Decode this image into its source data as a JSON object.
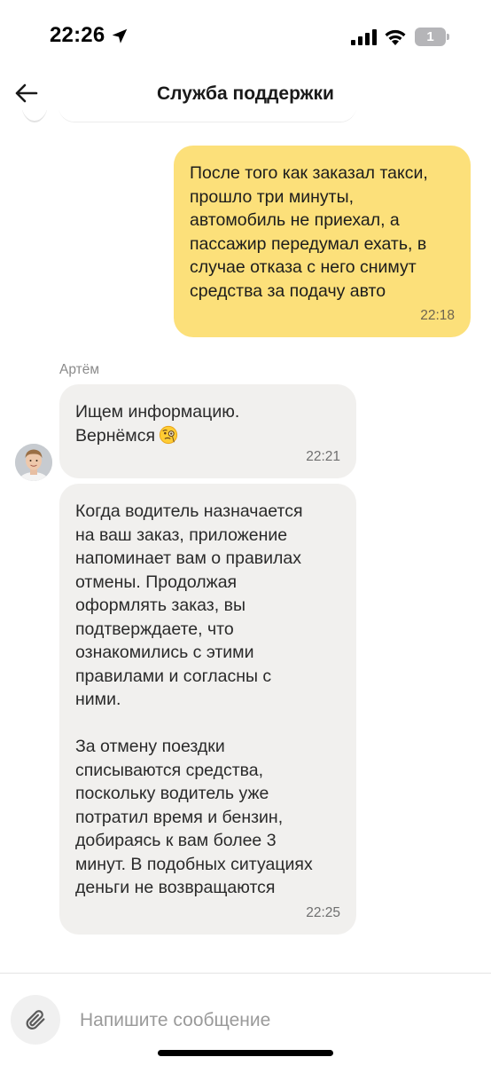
{
  "status_bar": {
    "time": "22:26",
    "battery_level": "1",
    "icons": [
      "location-arrow-icon",
      "cellular-signal-icon",
      "wifi-icon",
      "battery-icon"
    ]
  },
  "header": {
    "title": "Служба поддержки",
    "back_icon": "arrow-left-icon"
  },
  "chat": {
    "messages": [
      {
        "direction": "outgoing",
        "text": "После того как заказал такси,\nпрошло три минуты,\nавтомобиль не приехал, а\nпассажир передумал ехать, в\nслучае отказа с него снимут\nсредства за подачу авто",
        "time": "22:18"
      },
      {
        "direction": "incoming",
        "sender": "Артём",
        "text": "Ищем информацию.\nВернёмся",
        "emoji": "face-with-monocle",
        "time": "22:21"
      },
      {
        "direction": "incoming",
        "text": "Когда водитель назначается\nна ваш заказ, приложение\nнапоминает вам о правилах\nотмены. Продолжая\nоформлять заказ, вы\nподтверждаете, что\nознакомились с этими\nправилами и согласны с\nними.\n\nЗа отмену поездки\nсписываются средства,\nпоскольку водитель уже\nпотратил время и бензин,\nдобираясь к вам более 3\nминут. В подобных ситуациях\nденьги не возвращаются",
        "time": "22:25"
      }
    ]
  },
  "composer": {
    "placeholder": "Напишите сообщение",
    "value": "",
    "attach_icon": "paperclip-icon"
  },
  "colors": {
    "outgoing_bubble": "#fce07a",
    "incoming_bubble": "#f1f0ee",
    "background": "#ffffff"
  }
}
